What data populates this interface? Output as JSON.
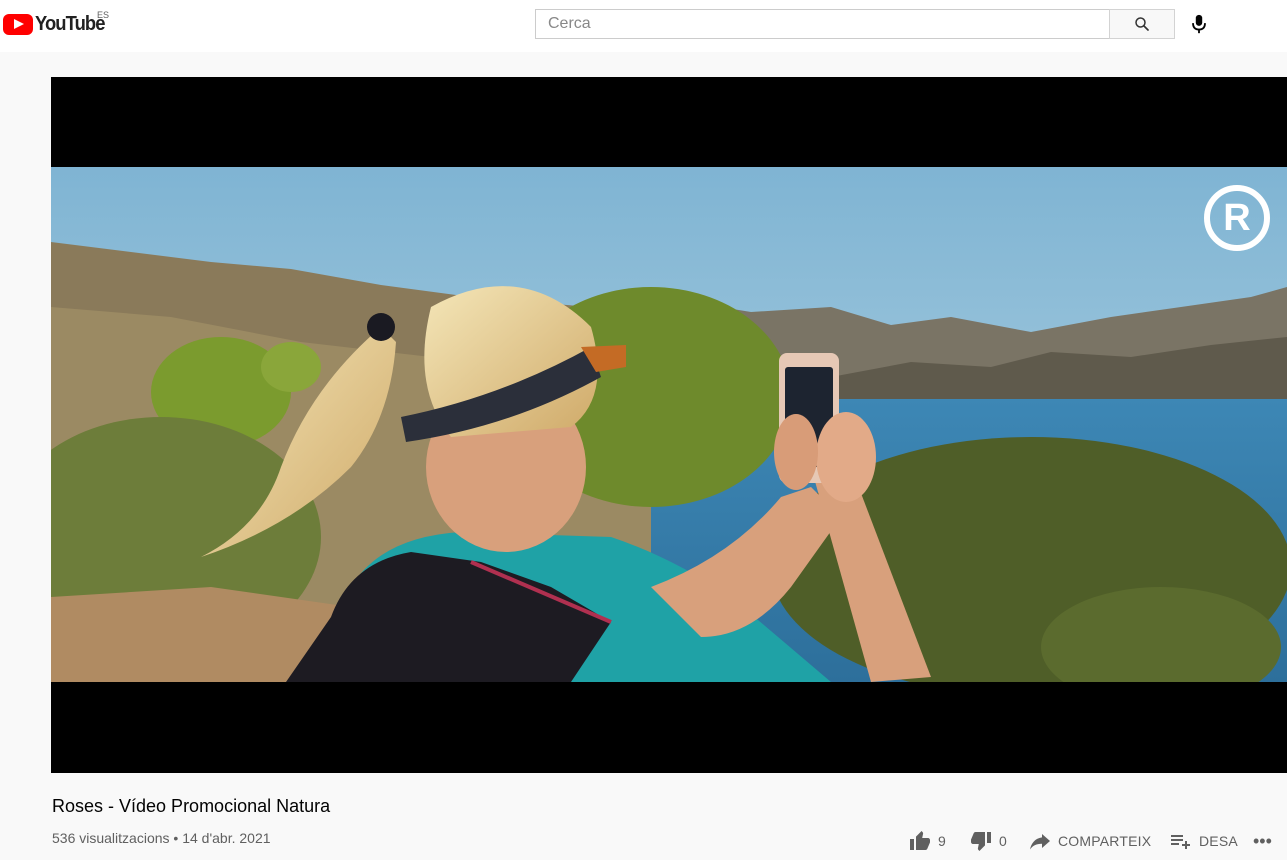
{
  "header": {
    "logo_text": "YouTube",
    "country_code": "ES",
    "search_placeholder": "Cerca",
    "icons": [
      "youtube-logo-icon",
      "search-icon",
      "microphone-icon"
    ]
  },
  "player": {
    "watermark_letter": "R"
  },
  "video": {
    "title": "Roses - Vídeo Promocional Natura",
    "views": "536 visualitzacions",
    "separator": "•",
    "date": "14 d'abr. 2021"
  },
  "actions": {
    "likes": "9",
    "dislikes": "0",
    "share_label": "COMPARTEIX",
    "save_label": "DESA",
    "more_label": "•••"
  },
  "colors": {
    "brand_red": "#ff0000",
    "page_bg": "#f9f9f9",
    "text_secondary": "#606060"
  }
}
